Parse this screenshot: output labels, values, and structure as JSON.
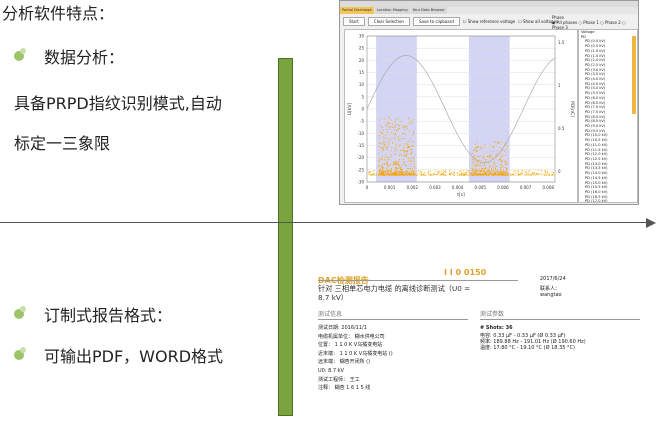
{
  "left": {
    "title": "分析软件特点：",
    "bullet1": "数据分析：",
    "desc_line1": "具备PRPD指纹识别模式,自动",
    "desc_line2": "标定一三象限",
    "bullet2": "订制式报告格式：",
    "bullet3": "可输出PDF，WORD格式"
  },
  "software": {
    "tabs": [
      "Partial Discharge",
      "Location Mapping",
      "Your Data Browser"
    ],
    "buttons": [
      "Start",
      "Clear Selection",
      "Save to clipboard"
    ],
    "checkboxes": [
      "Show reference voltage",
      "Show all voltages"
    ],
    "phase_label": "Phase",
    "phase_options": [
      "All phases",
      "Phase 1",
      "Phase 2",
      "Phase 3"
    ],
    "legend_header": [
      "Voltage",
      "PD"
    ],
    "legend_items": [
      "PD (0.0 kV)",
      "PD (0.5 kV)",
      "PD (1.0 kV)",
      "PD (1.5 kV)",
      "PD (2.0 kV)",
      "PD (2.5 kV)",
      "PD (3.0 kV)",
      "PD (3.5 kV)",
      "PD (4.0 kV)",
      "PD (4.5 kV)",
      "PD (5.0 kV)",
      "PD (5.5 kV)",
      "PD (6.0 kV)",
      "PD (6.5 kV)",
      "PD (7.0 kV)",
      "PD (7.5 kV)",
      "PD (8.0 kV)",
      "PD (8.5 kV)",
      "PD (9.0 kV)",
      "PD (9.5 kV)",
      "PD (10.0 kV)",
      "PD (10.5 kV)",
      "PD (11.0 kV)",
      "PD (11.5 kV)",
      "PD (12.0 kV)",
      "PD (12.5 kV)",
      "PD (13.0 kV)",
      "PD (13.5 kV)",
      "PD (14.0 kV)",
      "PD (14.5 kV)",
      "PD (15.0 kV)",
      "PD (15.5 kV)",
      "PD (16.0 kV)",
      "PD (16.5 kV)",
      "PD (17.0 kV)"
    ],
    "y_label": "U[kV]",
    "y2_label": "PD[nC]",
    "x_label": "t[s]",
    "y_ticks": [
      "30",
      "25",
      "20",
      "15",
      "10",
      "5",
      "0",
      "-5",
      "-10",
      "-15",
      "-20",
      "-25",
      "-30"
    ],
    "y2_ticks": [
      "1.5",
      "1",
      "0.5",
      "0"
    ],
    "x_ticks": [
      "0",
      "0.001",
      "0.002",
      "0.003",
      "0.004",
      "0.005",
      "0.006",
      "0.007",
      "0.008"
    ]
  },
  "report": {
    "title": "DAC检测报告",
    "number": "I I 0 0150",
    "subtitle_line1": "针对 三相单芯电力电缆 的离线诊断测试（U0 =",
    "subtitle_line2": "8.7 kV）",
    "date": "2017/6/24",
    "contact_label": "联系人：",
    "contact_name": "wangtao",
    "section_left": "测试信息",
    "section_right": "测试参数",
    "info": [
      "测试日期: 2016/11/1",
      "电缆机属单位： 糊水供电公司",
      "位置： 1 1 0 K V乌橘变电站",
      "近末端： 1 1 0 K V乌橘变电站 ()",
      "远末端： 糊杏开闭所 ()",
      "U0: 8.7 kV",
      "测试工程师： 王工",
      "注释： 糊杏 1 6 1 5 线"
    ],
    "params": [
      "# Shots: 36",
      "电容: 0.33 µF - 0.33 µF (Ø 0.33 µF)",
      "频率: 189.88 Hz - 191.01 Hz (Ø 190.60 Hz)",
      "温度: 17.80 °C - 19.10 °C (Ø 18.35 °C)"
    ]
  },
  "colors": {
    "bar": "#7aa43d",
    "report_accent": "#e0a12b",
    "pd_points": "#f5a400",
    "band": "#c9cbf2"
  }
}
